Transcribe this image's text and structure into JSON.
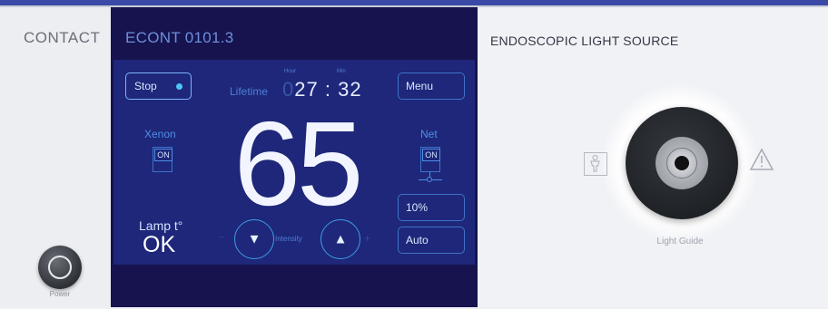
{
  "left": {
    "brand": "CONTACT",
    "power_label": "Power"
  },
  "screen": {
    "title": "ECONT 0101.3",
    "stop_label": "Stop",
    "menu_label": "Menu",
    "lifetime_label": "Lifetime",
    "hour_label": "Hour",
    "min_label": "Min",
    "hours_prefix": "0",
    "hours_value": "27",
    "time_separator": ":",
    "minutes_value": "32",
    "xenon_label": "Xenon",
    "xenon_toggle": "ON",
    "net_label": "Net",
    "net_toggle": "ON",
    "intensity_value": "65",
    "percent_button": "10%",
    "auto_button": "Auto",
    "lamp_label": "Lamp t°",
    "lamp_status": "OK",
    "intensity_label": "Intensity",
    "minus_sign": "−",
    "plus_sign": "+"
  },
  "right": {
    "title": "ENDOSCOPIC LIGHT SOURCE",
    "light_guide_label": "Light Guide"
  },
  "icons": {
    "stop_indicator": "status-dot",
    "down": "triangle-down",
    "up": "triangle-up",
    "patient": "bf-patient-symbol",
    "warning": "warning-triangle"
  },
  "colors": {
    "screen_bg": "#16134f",
    "screen_panel": "#1e2779",
    "accent": "#4fc3f7",
    "panel_bg": "#eef0f4"
  }
}
